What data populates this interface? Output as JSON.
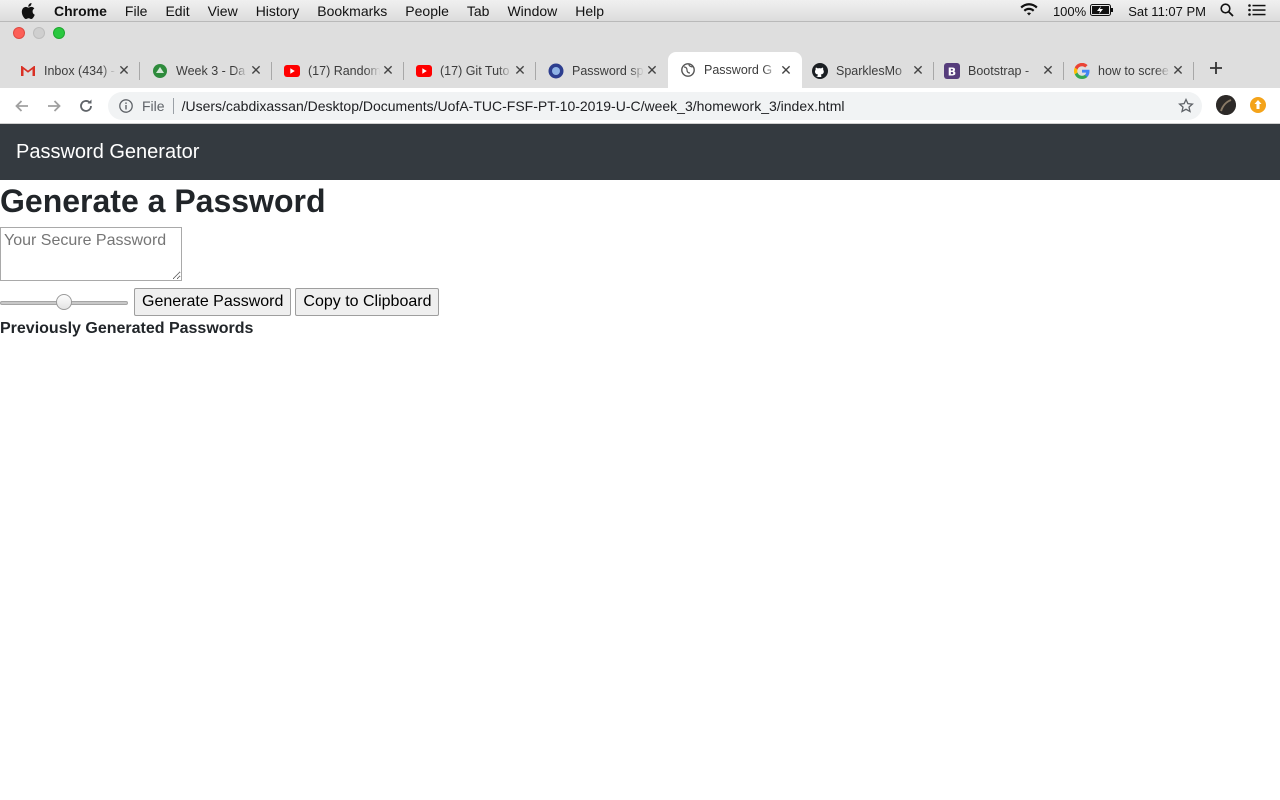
{
  "menubar": {
    "app": "Chrome",
    "items": [
      "File",
      "Edit",
      "View",
      "History",
      "Bookmarks",
      "People",
      "Tab",
      "Window",
      "Help"
    ],
    "battery": "100%",
    "clock": "Sat 11:07 PM"
  },
  "tabs": [
    {
      "title": "Inbox (434) -",
      "icon": "gmail-icon"
    },
    {
      "title": "Week 3 - Da",
      "icon": "drive-icon"
    },
    {
      "title": "(17) Random",
      "icon": "youtube-icon"
    },
    {
      "title": "(17) Git Tuto",
      "icon": "youtube-icon"
    },
    {
      "title": "Password sp",
      "icon": "globe-icon"
    },
    {
      "title": "Password G",
      "icon": "globe-icon",
      "active": true
    },
    {
      "title": "SparklesMo",
      "icon": "github-icon"
    },
    {
      "title": "Bootstrap -",
      "icon": "bootstrap-icon"
    },
    {
      "title": "how to scree",
      "icon": "google-icon"
    }
  ],
  "addressbar": {
    "scheme_label": "File",
    "url": "/Users/cabdixassan/Desktop/Documents/UofA-TUC-FSF-PT-10-2019-U-C/week_3/homework_3/index.html"
  },
  "page": {
    "brand": "Password Generator",
    "heading": "Generate a Password",
    "password_placeholder": "Your Secure Password",
    "password_value": "",
    "length_slider_fraction": 0.5,
    "generate_label": "Generate Password",
    "copy_label": "Copy to Clipboard",
    "previous_heading": "Previously Generated Passwords"
  }
}
